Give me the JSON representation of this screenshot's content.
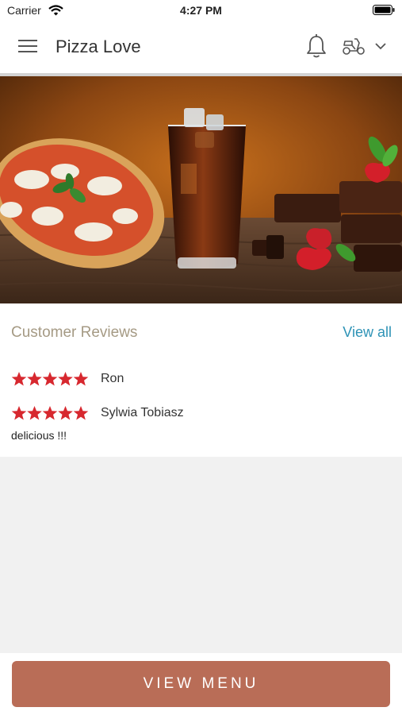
{
  "status_bar": {
    "carrier": "Carrier",
    "time": "4:27 PM"
  },
  "navbar": {
    "title": "Pizza Love",
    "icons": [
      "menu-icon",
      "bell-icon",
      "scooter-icon",
      "chevron-down-icon"
    ]
  },
  "hero": {
    "image": "pizza, iced cola glass and chocolate brownies with strawberries on wooden table"
  },
  "reviews": {
    "title": "Customer Reviews",
    "view_all": "View all",
    "items": [
      {
        "name": "Ron",
        "rating": 5,
        "comment": ""
      },
      {
        "name": "Sylwia Tobiasz",
        "rating": 5,
        "comment": "delicious !!!"
      }
    ]
  },
  "bottom": {
    "button_label": "VIEW MENU"
  },
  "colors": {
    "accent_button": "#b96d57",
    "star": "#d7282f",
    "link": "#2e93b6",
    "section_title": "#a59a84"
  }
}
